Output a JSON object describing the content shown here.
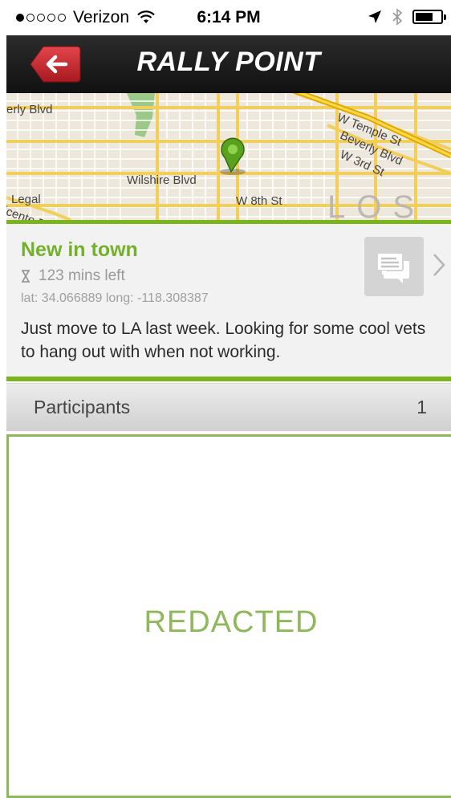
{
  "status_bar": {
    "carrier": "Verizon",
    "time": "6:14 PM",
    "signal_bars_filled": 1,
    "signal_bars_total": 5,
    "icons": [
      "wifi-icon",
      "location-arrow-icon",
      "bluetooth-icon",
      "battery-icon"
    ]
  },
  "nav": {
    "title": "RALLY POINT",
    "back_icon": "back-arrow-icon",
    "accent": "#c9252c"
  },
  "map": {
    "labels": {
      "beverly_left": "erly Blvd",
      "w_temple": "W Temple St",
      "beverly_right": "Beverly Blvd",
      "w_third": "W 3rd St",
      "wilshire": "Wilshire Blvd",
      "legal": "Legal",
      "w_eighth": "W 8th St",
      "vicente": "icente B",
      "city": "LOS AN"
    },
    "pin_icon": "map-pin-icon"
  },
  "rally": {
    "title": "New in town",
    "time_left": "123 mins left",
    "coords": "lat: 34.066889 long: -118.308387",
    "description": "Just move to LA last week. Looking for some cool vets to hang out with when not working.",
    "chat_icon": "chat-bubble-icon"
  },
  "participants": {
    "label": "Participants",
    "count": "1"
  },
  "redacted": {
    "text": "REDACTED"
  },
  "colors": {
    "accent_green": "#72b129",
    "rule_green": "#7ab51d",
    "redacted_green": "#8fb85a",
    "nav_black": "#1a1a1a"
  }
}
